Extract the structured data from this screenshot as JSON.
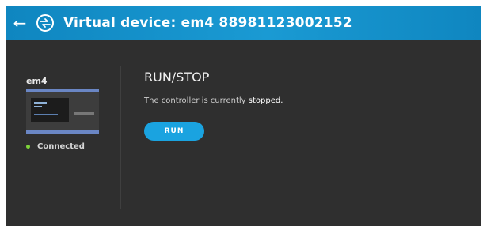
{
  "header": {
    "back_icon": "arrow-left-icon",
    "logo_icon": "device-logo-icon",
    "title": "Virtual device: em4 88981123002152",
    "background": "#1a9ad3"
  },
  "sidebar": {
    "device_name": "em4",
    "thumbnail_icon": "device-thumbnail",
    "status": {
      "label": "Connected",
      "color": "#7ed43a"
    }
  },
  "main": {
    "heading": "RUN/STOP",
    "message_prefix": "The controller is currently ",
    "message_state": "stopped.",
    "run_button_label": "RUN",
    "accent": "#1aa3e0"
  }
}
